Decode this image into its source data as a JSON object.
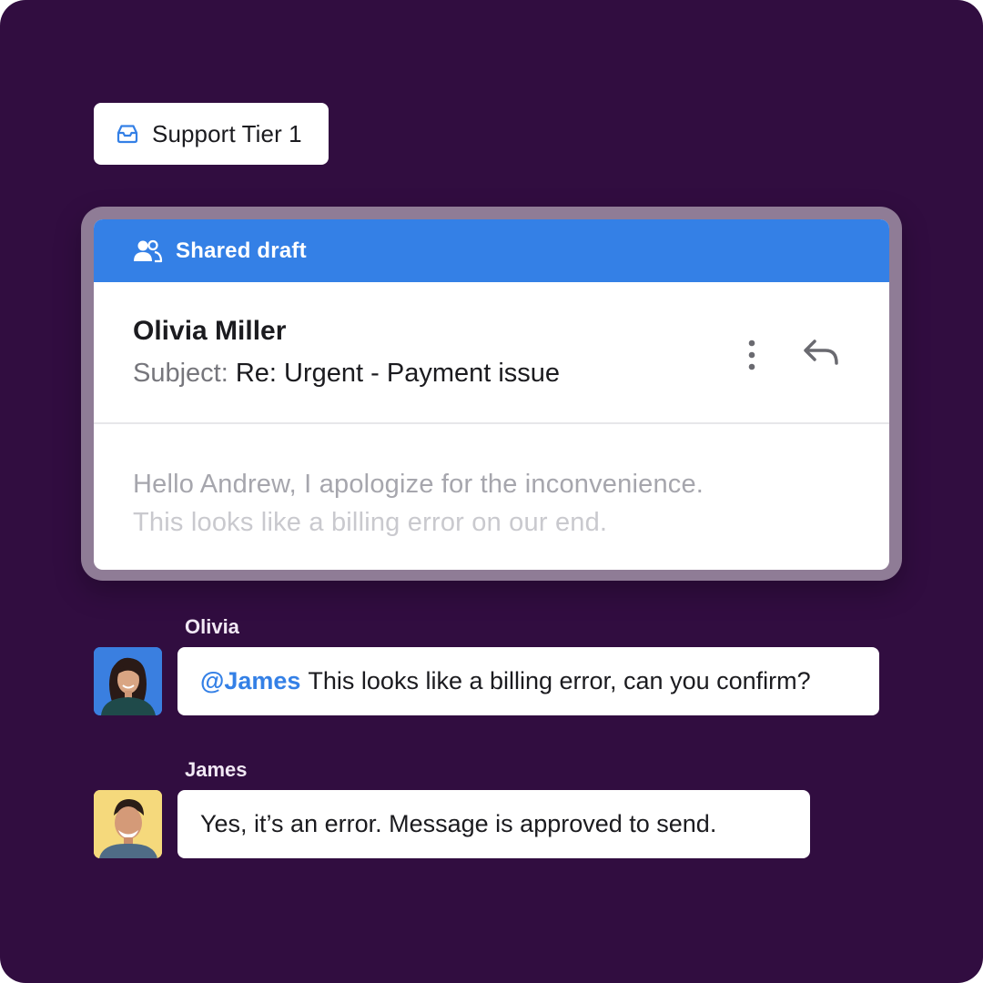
{
  "inbox": {
    "label": "Support Tier 1",
    "icon": "inbox-icon"
  },
  "draft": {
    "header_label": "Shared draft",
    "header_icon": "users-icon",
    "sender": "Olivia Miller",
    "subject_label": "Subject:",
    "subject": "Re: Urgent - Payment issue",
    "body_line1": "Hello Andrew, I apologize for the inconvenience.",
    "body_line2": "This looks like a billing error on our end.",
    "accent_color": "#3480e6"
  },
  "comments": [
    {
      "author": "Olivia",
      "mention": "@James",
      "text": "This looks like a billing error, can you confirm?",
      "avatar_bg": "#3a7fe0"
    },
    {
      "author": "James",
      "text": "Yes, it’s an error. Message is approved to send.",
      "avatar_bg": "#f5d97c"
    }
  ],
  "colors": {
    "background": "#310d40",
    "mention": "#3480e6"
  }
}
